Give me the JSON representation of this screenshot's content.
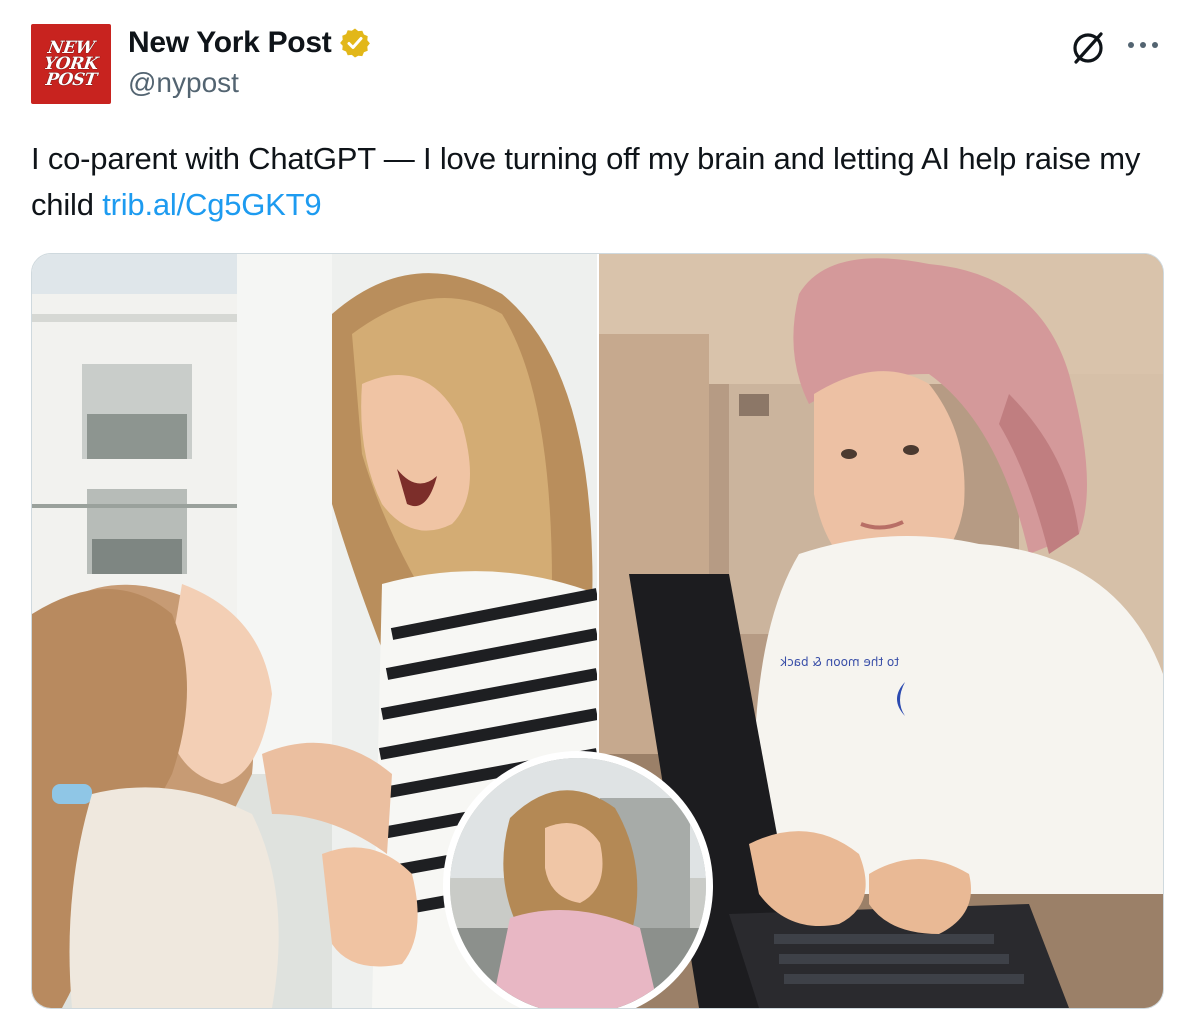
{
  "tweet": {
    "author": {
      "name": "New York Post",
      "handle": "@nypost",
      "verified": true,
      "avatar_lines": [
        "NEW",
        "YORK",
        "POST"
      ]
    },
    "text": "I co-parent with ChatGPT — I love turning off my brain and letting AI help raise my child",
    "link": "trib.al/Cg5GKT9",
    "icons": {
      "grok": "grok-icon",
      "more": "more-icon",
      "verified": "verified-badge-icon"
    },
    "media": {
      "shirt_text": "to the moon & back"
    }
  },
  "colors": {
    "link": "#1d9bf0",
    "handle": "#536471",
    "avatar_bg": "#c8231f",
    "verified": "#e2b719"
  }
}
